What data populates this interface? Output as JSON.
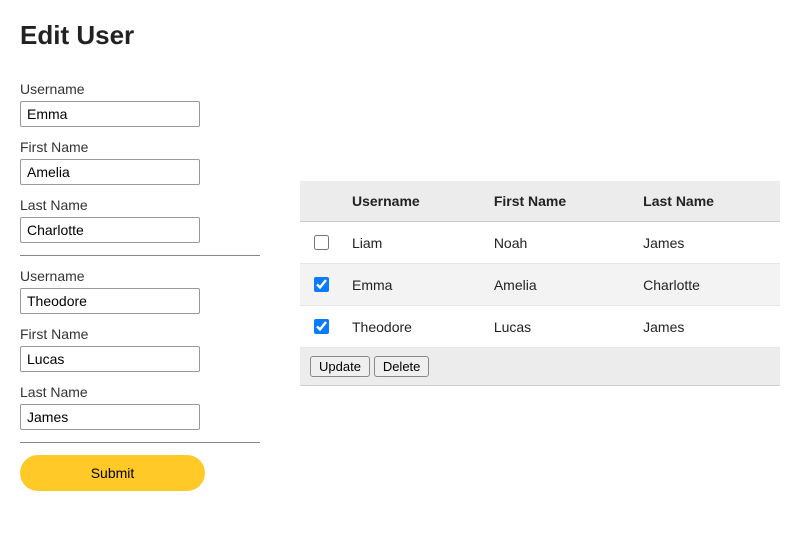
{
  "page": {
    "title": "Edit User"
  },
  "form": {
    "blocks": [
      {
        "username_label": "Username",
        "username_value": "Emma",
        "firstname_label": "First Name",
        "firstname_value": "Amelia",
        "lastname_label": "Last Name",
        "lastname_value": "Charlotte"
      },
      {
        "username_label": "Username",
        "username_value": "Theodore",
        "firstname_label": "First Name",
        "firstname_value": "Lucas",
        "lastname_label": "Last Name",
        "lastname_value": "James"
      }
    ],
    "submit_label": "Submit"
  },
  "table": {
    "headers": {
      "username": "Username",
      "firstname": "First Name",
      "lastname": "Last Name"
    },
    "rows": [
      {
        "checked": false,
        "username": "Liam",
        "firstname": "Noah",
        "lastname": "James"
      },
      {
        "checked": true,
        "username": "Emma",
        "firstname": "Amelia",
        "lastname": "Charlotte"
      },
      {
        "checked": true,
        "username": "Theodore",
        "firstname": "Lucas",
        "lastname": "James"
      }
    ],
    "actions": {
      "update_label": "Update",
      "delete_label": "Delete"
    }
  }
}
